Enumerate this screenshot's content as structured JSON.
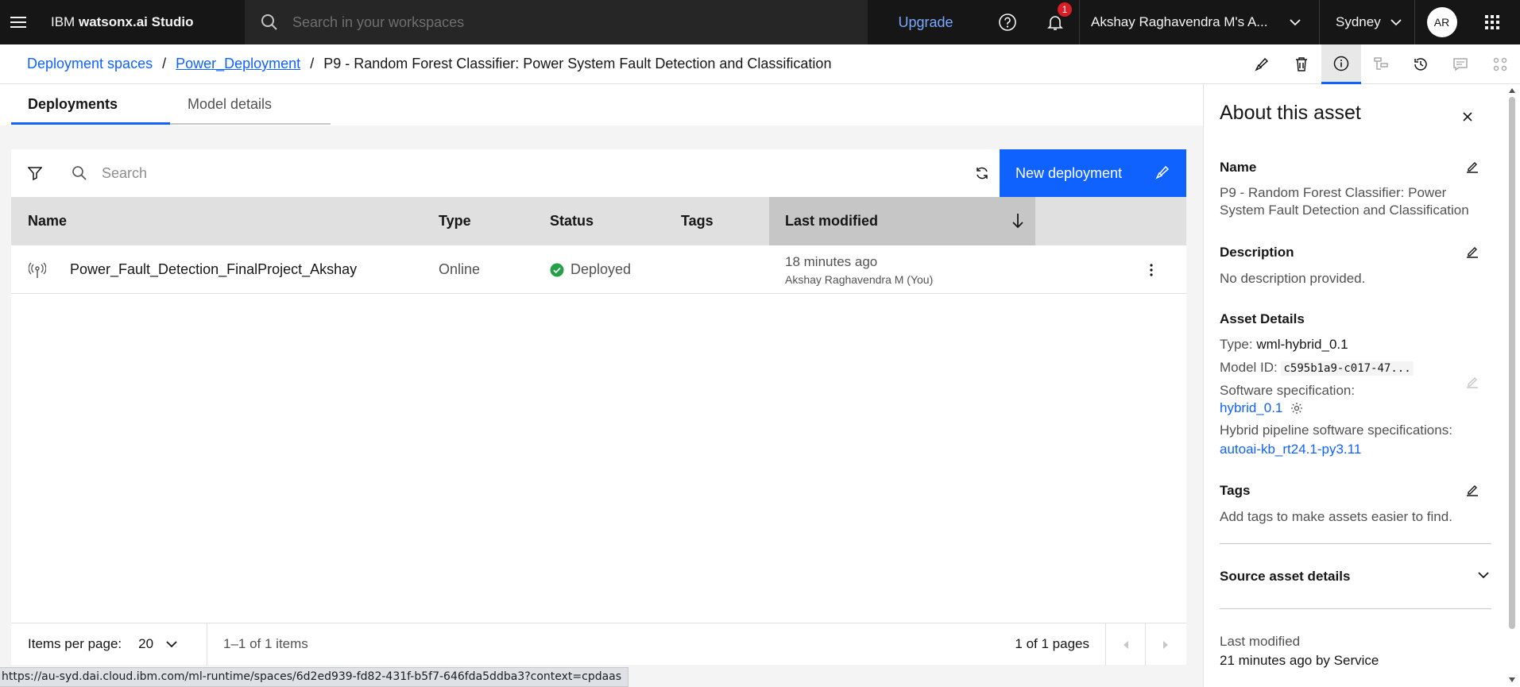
{
  "header": {
    "brand_prefix": "IBM",
    "brand_name": "watsonx.ai Studio",
    "search_placeholder": "Search in your workspaces",
    "upgrade_label": "Upgrade",
    "notification_count": "1",
    "account_name": "Akshay Raghavendra M's A...",
    "region": "Sydney",
    "avatar_initials": "AR"
  },
  "breadcrumb": {
    "items": [
      "Deployment spaces",
      "Power_Deployment",
      "P9 - Random Forest Classifier: Power System Fault Detection and Classification"
    ],
    "separator": "/"
  },
  "tabs": [
    {
      "label": "Deployments",
      "active": true
    },
    {
      "label": "Model details",
      "active": false
    }
  ],
  "table": {
    "search_placeholder": "Search",
    "new_deployment_label": "New deployment",
    "columns": [
      "Name",
      "Type",
      "Status",
      "Tags",
      "Last modified"
    ],
    "rows": [
      {
        "name": "Power_Fault_Detection_FinalProject_Akshay",
        "type": "Online",
        "status": "Deployed",
        "tags": "",
        "last_modified": "18 minutes ago",
        "modified_by": "Akshay Raghavendra M (You)"
      }
    ]
  },
  "pagination": {
    "items_per_page_label": "Items per page:",
    "items_per_page": "20",
    "range": "1–1 of 1 items",
    "pages": "1 of 1 pages"
  },
  "status_url": "https://au-syd.dai.cloud.ibm.com/ml-runtime/spaces/6d2ed939-fd82-431f-b5f7-646fda5ddba3?context=cpdaas",
  "side_panel": {
    "title": "About this asset",
    "name_title": "Name",
    "name_value": "P9 - Random Forest Classifier: Power System Fault Detection and Classification",
    "description_title": "Description",
    "description_value": "No description provided.",
    "asset_details_title": "Asset Details",
    "type_label": "Type:",
    "type_value": "wml-hybrid_0.1",
    "model_id_label": "Model ID:",
    "model_id_value": "c595b1a9-c017-47...",
    "software_spec_label": "Software specification:",
    "software_spec_value": "hybrid_0.1",
    "hybrid_spec_label": "Hybrid pipeline software specifications:",
    "hybrid_spec_value": "autoai-kb_rt24.1-py3.11",
    "tags_title": "Tags",
    "tags_value": "Add tags to make assets easier to find.",
    "source_title": "Source asset details",
    "last_modified_label": "Last modified",
    "last_modified_value": "21 minutes ago by Service"
  },
  "colors": {
    "accent": "#0f62fe",
    "header_bg": "#161616",
    "deployed_green": "#24a148"
  }
}
